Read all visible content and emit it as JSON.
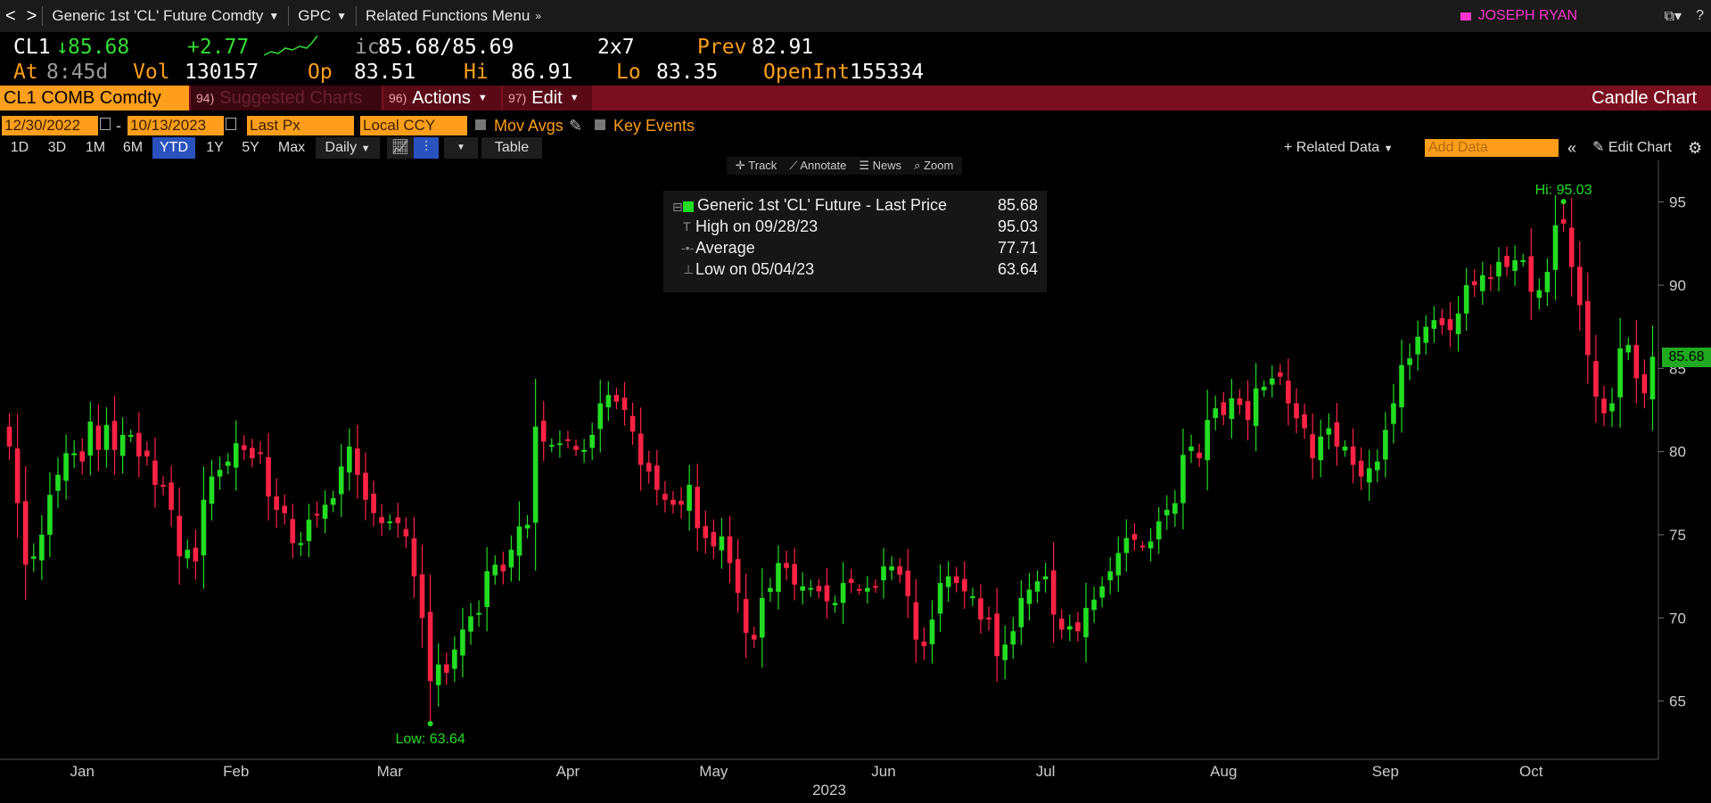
{
  "navbar": {
    "back": "<",
    "forward": ">",
    "security_menu": "Generic 1st 'CL' Future Comdty",
    "gpc": "GPC",
    "related": "Related Functions Menu",
    "user": "JOSEPH RYAN",
    "help": "?",
    "window_icon": "window-icon"
  },
  "quote": {
    "ticker": "CL1",
    "last": "85.68",
    "change": "+2.77",
    "bid_ask": "85.68/85.69",
    "size": "2x7",
    "prev_label": "Prev",
    "prev": "82.91",
    "at_label": "At",
    "time": "8:45d",
    "vol_label": "Vol",
    "vol": "130157",
    "op_label": "Op",
    "op": "83.51",
    "hi_label": "Hi",
    "hi": "86.91",
    "lo_label": "Lo",
    "lo": "83.35",
    "oi_label": "OpenInt",
    "oi": "155334"
  },
  "funcbar": {
    "security": "CL1 COMB Comdty",
    "suggested_num": "94)",
    "suggested": "Suggested Charts",
    "actions_num": "96)",
    "actions": "Actions",
    "edit_num": "97)",
    "edit": "Edit",
    "title": "Candle Chart"
  },
  "controls": {
    "start_date": "12/30/2022",
    "end_date": "10/13/2023",
    "field": "Last Px",
    "currency": "Local CCY",
    "mov_avgs": "Mov Avgs",
    "key_events": "Key Events",
    "periods": [
      "1D",
      "3D",
      "1M",
      "6M",
      "YTD",
      "1Y",
      "5Y",
      "Max"
    ],
    "active_period": "YTD",
    "frequency": "Daily",
    "table": "Table",
    "related_data": "Related Data",
    "add_data_placeholder": "Add Data",
    "edit_chart": "Edit Chart",
    "tools": [
      "Track",
      "Annotate",
      "News",
      "Zoom"
    ]
  },
  "legend": {
    "series": "Generic 1st 'CL' Future - Last Price",
    "series_value": "85.68",
    "high_label": "High on 09/28/23",
    "high_value": "95.03",
    "avg_label": "Average",
    "avg_value": "77.71",
    "low_label": "Low on 05/04/23",
    "low_value": "63.64"
  },
  "chart_data": {
    "type": "candlestick",
    "title": "",
    "xlabel": "2023",
    "x_ticks": [
      "Jan",
      "Feb",
      "Mar",
      "Apr",
      "May",
      "Jun",
      "Jul",
      "Aug",
      "Sep",
      "Oct"
    ],
    "y_ticks": [
      65,
      70,
      75,
      80,
      85,
      90,
      95
    ],
    "ylim": [
      61.5,
      97.5
    ],
    "y_axis_side": "right",
    "last_price": "85.68",
    "hi_annotation": "Hi: 95.03",
    "lo_annotation": "Low: 63.64",
    "up_color": "#22dd22",
    "down_color": "#ff2244",
    "closes": [
      80.3,
      76.9,
      73.2,
      73.7,
      75.0,
      77.4,
      78.6,
      79.9,
      79.9,
      79.4,
      81.8,
      80.1,
      81.6,
      80.1,
      81.0,
      81.0,
      79.7,
      79.7,
      78.0,
      77.9,
      76.5,
      73.7,
      74.1,
      73.4,
      77.1,
      78.5,
      78.9,
      79.4,
      80.5,
      80.1,
      79.6,
      79.9,
      77.3,
      76.5,
      76.3,
      74.5,
      74.5,
      75.9,
      76.2,
      76.8,
      77.2,
      79.1,
      80.3,
      78.6,
      77.1,
      76.3,
      75.7,
      75.8,
      75.7,
      74.9,
      72.5,
      70.0,
      66.2,
      67.2,
      66.7,
      68.1,
      69.3,
      70.1,
      70.3,
      72.8,
      73.2,
      72.8,
      74.1,
      75.5,
      75.6,
      81.5,
      80.6,
      80.4,
      80.5,
      80.7,
      80.1,
      80.1,
      81.0,
      82.9,
      83.4,
      83.0,
      82.5,
      81.2,
      79.2,
      78.8,
      77.7,
      77.1,
      76.8,
      76.8,
      78.0,
      75.4,
      74.8,
      74.3,
      74.9,
      73.3,
      71.5,
      69.1,
      68.7,
      71.2,
      71.8,
      73.3,
      73.0,
      72.0,
      71.9,
      71.8,
      71.6,
      71.0,
      70.9,
      72.1,
      72.1,
      71.7,
      71.8,
      71.9,
      73.1,
      73.1,
      72.6,
      71.3,
      68.7,
      68.3,
      69.9,
      72.1,
      72.5,
      72.1,
      71.6,
      71.3,
      69.9,
      69.9,
      67.7,
      68.4,
      69.2,
      71.2,
      71.7,
      72.2,
      72.5,
      70.2,
      69.3,
      69.5,
      69.2,
      70.6,
      71.1,
      71.9,
      72.8,
      73.9,
      74.8,
      74.7,
      74.3,
      74.6,
      75.8,
      76.5,
      76.9,
      79.8,
      80.3,
      79.6,
      81.9,
      82.6,
      82.2,
      83.2,
      82.8,
      81.9,
      83.8,
      83.9,
      84.4,
      84.5,
      82.9,
      82.0,
      81.4,
      79.6,
      80.9,
      81.4,
      80.3,
      80.3,
      79.2,
      78.5,
      79.0,
      79.4,
      81.3,
      82.9,
      85.2,
      85.6,
      86.9,
      87.5,
      87.9,
      87.6,
      87.3,
      88.3,
      90.0,
      90.0,
      90.6,
      90.4,
      91.4,
      91.1,
      91.5,
      91.5,
      89.6,
      89.7,
      90.8,
      93.6,
      93.7,
      91.1,
      88.8,
      85.8,
      83.3,
      82.3,
      82.9,
      86.2,
      86.4,
      84.4,
      83.5,
      85.7
    ]
  }
}
